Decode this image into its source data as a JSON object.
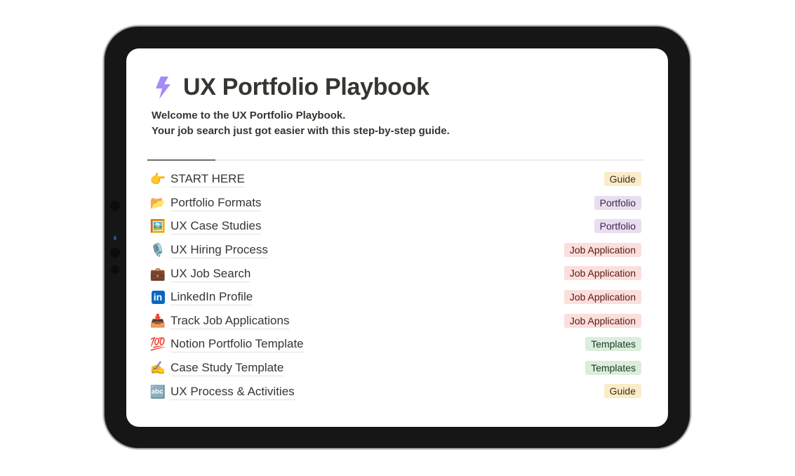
{
  "page": {
    "icon": "lightning-bolt-icon",
    "title": "UX Portfolio Playbook",
    "intro_lines": [
      "Welcome to the UX Portfolio Playbook.",
      "Your job search just got easier with this step-by-step guide."
    ]
  },
  "tag_colors": {
    "Guide": "#fbecc8",
    "Portfolio": "#e8deee",
    "Job Application": "#fadfdc",
    "Templates": "#dbeddb"
  },
  "items": [
    {
      "icon": "pointing-hand-icon",
      "emoji": "👉",
      "title": "START HERE",
      "tag": "Guide",
      "tag_class": "tag-guide"
    },
    {
      "icon": "folder-icon",
      "emoji": "📂",
      "title": "Portfolio Formats",
      "tag": "Portfolio",
      "tag_class": "tag-portfolio"
    },
    {
      "icon": "framed-picture-icon",
      "emoji": "🖼️",
      "title": "UX Case Studies",
      "tag": "Portfolio",
      "tag_class": "tag-portfolio"
    },
    {
      "icon": "microphone-icon",
      "emoji": "🎙️",
      "title": "UX Hiring Process",
      "tag": "Job Application",
      "tag_class": "tag-job"
    },
    {
      "icon": "briefcase-icon",
      "emoji": "💼",
      "title": "UX Job Search",
      "tag": "Job Application",
      "tag_class": "tag-job"
    },
    {
      "icon": "linkedin-icon",
      "emoji": "in",
      "title": "LinkedIn Profile",
      "tag": "Job Application",
      "tag_class": "tag-job"
    },
    {
      "icon": "inbox-tray-icon",
      "emoji": "📥",
      "title": "Track Job Applications",
      "tag": "Job Application",
      "tag_class": "tag-job"
    },
    {
      "icon": "hundred-points-icon",
      "emoji": "💯",
      "title": "Notion Portfolio Template",
      "tag": "Templates",
      "tag_class": "tag-templates"
    },
    {
      "icon": "writing-hand-icon",
      "emoji": "✍️",
      "title": "Case Study Template",
      "tag": "Templates",
      "tag_class": "tag-templates"
    },
    {
      "icon": "abc-input-icon",
      "emoji": "🔤",
      "title": "UX Process & Activities",
      "tag": "Guide",
      "tag_class": "tag-guide"
    }
  ]
}
